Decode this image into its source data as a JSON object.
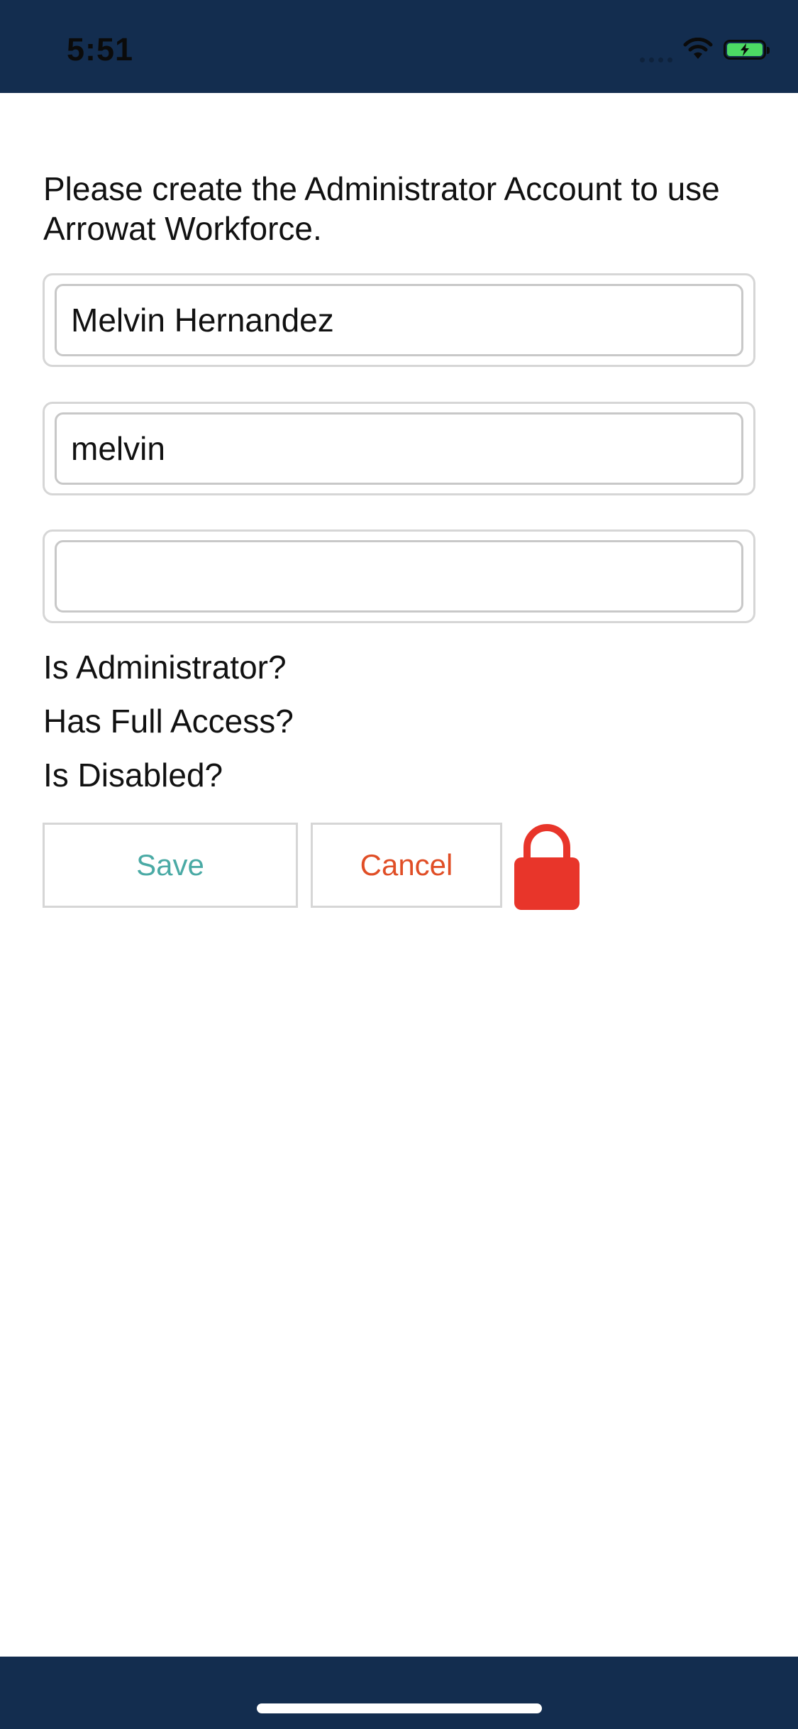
{
  "status_bar": {
    "time": "5:51"
  },
  "form": {
    "intro": "Please create the Administrator Account to use Arrowat Workforce.",
    "full_name_value": "Melvin Hernandez",
    "username_value": "melvin",
    "password_value": "",
    "options": {
      "is_administrator": "Is Administrator?",
      "has_full_access": "Has Full Access?",
      "is_disabled": "Is Disabled?"
    },
    "save_label": "Save",
    "cancel_label": "Cancel"
  },
  "colors": {
    "header_background": "#132d4f",
    "save_text": "#4aaaa5",
    "cancel_text": "#e04e26",
    "lock_icon": "#e8352a",
    "battery": "#4cd964"
  },
  "icons": {
    "wifi": "wifi-icon",
    "battery": "battery-charging-icon",
    "lock": "lock-icon"
  }
}
